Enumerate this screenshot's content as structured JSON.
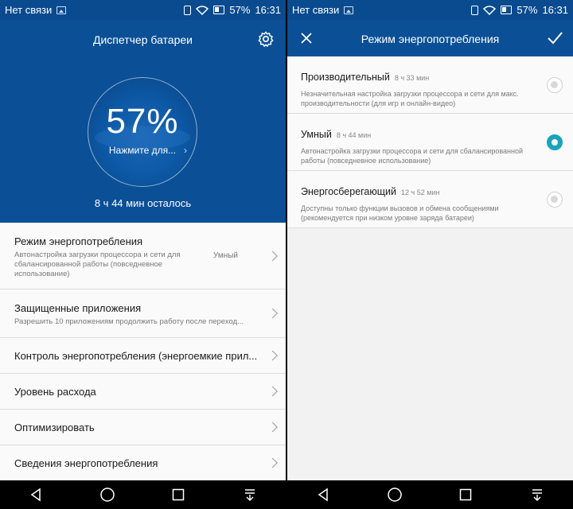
{
  "status": {
    "carrier": "Нет связи",
    "battery": "57%",
    "time": "16:31"
  },
  "left": {
    "title": "Диспетчер батареи",
    "percent": "57%",
    "tap_label": "Нажмите для...",
    "remaining": "8 ч 44 мин осталось",
    "items": [
      {
        "title": "Режим энергопотребления",
        "subtitle": "Автонастройка загрузки процессора и сети для сбалансированной работы (повседневное использование)",
        "value": "Умный"
      },
      {
        "title": "Защищенные приложения",
        "subtitle": "Разрешить 10 приложениям продолжить работу после переход..."
      },
      {
        "title": "Контроль энергопотребления (энергоемкие прил..."
      },
      {
        "title": "Уровень расхода"
      },
      {
        "title": "Оптимизировать"
      },
      {
        "title": "Сведения энергопотребления"
      }
    ]
  },
  "right": {
    "title": "Режим энергопотребления",
    "options": [
      {
        "name": "Производительный",
        "time": "8 ч 33 мин",
        "desc": "Незначительная настройка загрузки процессора и сети для макс. производительности (для игр и онлайн-видео)",
        "selected": false
      },
      {
        "name": "Умный",
        "time": "8 ч 44 мин",
        "desc": "Автонастройка загрузки процессора и сети для сбалансированной работы (повседневное использование)",
        "selected": true
      },
      {
        "name": "Энергосберегающий",
        "time": "12 ч 52 мин",
        "desc": "Доступны только функции вызовов и обмена сообщениями (рекомендуется при низком уровне заряда батареи)",
        "selected": false
      }
    ]
  },
  "colors": {
    "header": "#0b4f96",
    "accent": "#19a5b8"
  },
  "icons": {
    "settings": "gear-icon",
    "close": "close-icon",
    "confirm": "check-icon",
    "back": "back-icon",
    "home": "home-icon",
    "recents": "recents-icon",
    "notifications": "notification-pull-icon"
  }
}
